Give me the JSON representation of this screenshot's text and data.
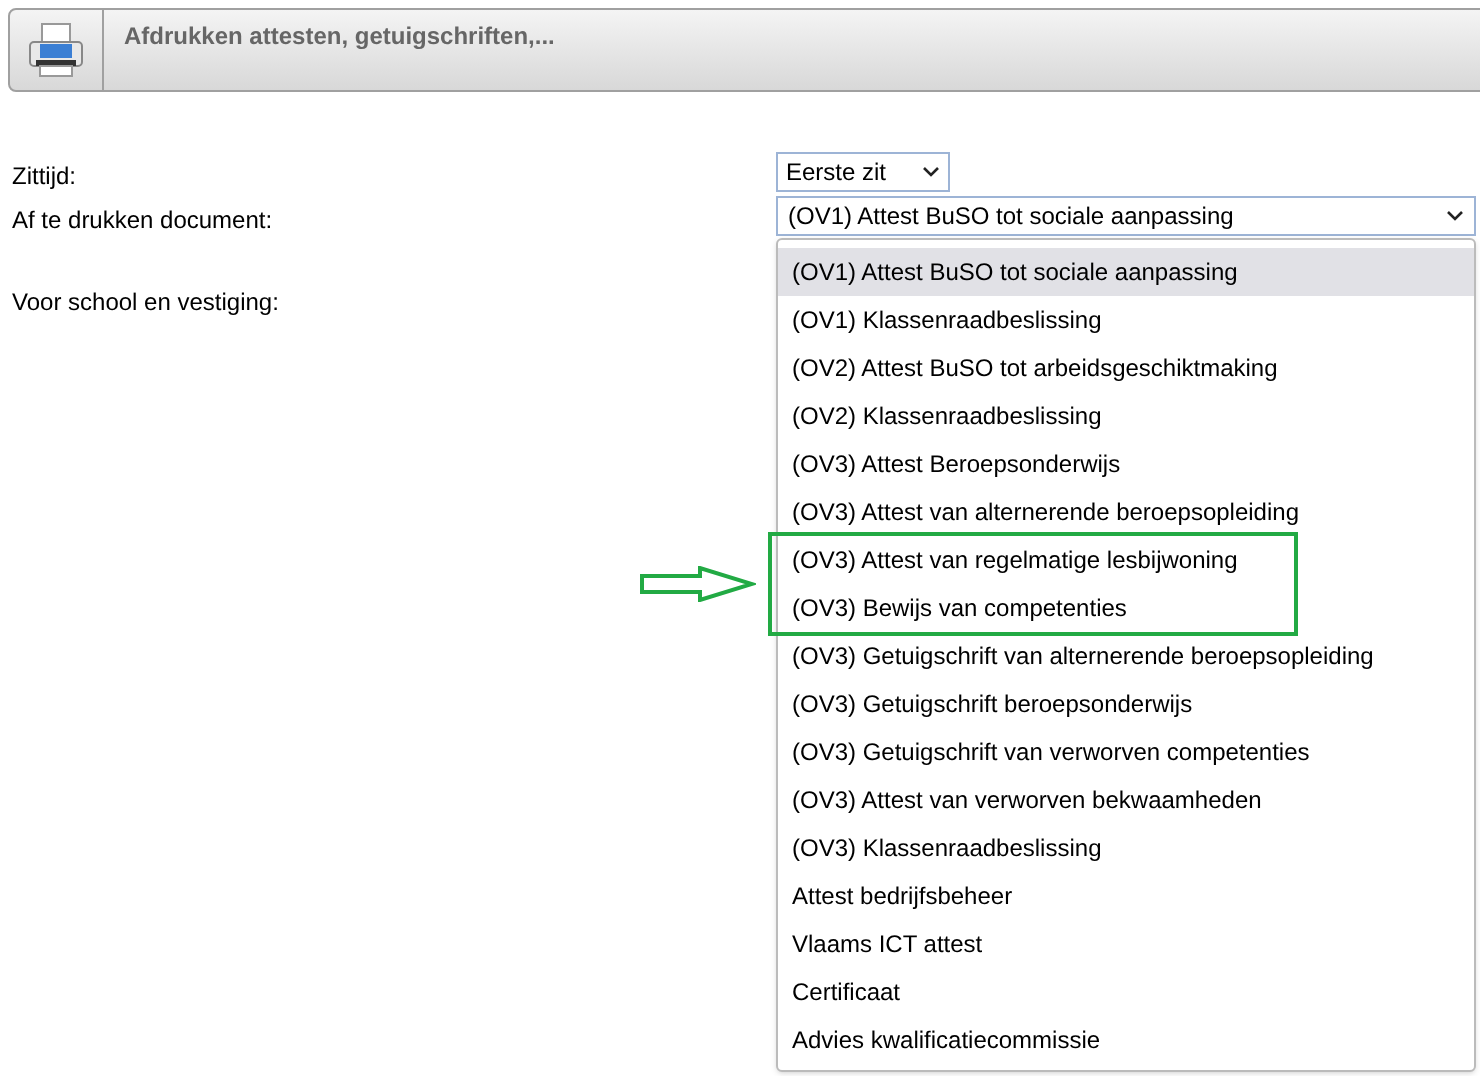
{
  "header": {
    "title": "Afdrukken attesten, getuigschriften,..."
  },
  "form": {
    "session_label": "Zittijd:",
    "session_value": "Eerste zit",
    "document_label": "Af te drukken document:",
    "document_value": "(OV1) Attest BuSO tot sociale aanpassing",
    "school_label": "Voor school en vestiging:"
  },
  "dropdown_options": [
    {
      "label": "(OV1) Attest BuSO tot sociale aanpassing",
      "selected": true,
      "highlighted": false
    },
    {
      "label": "(OV1) Klassenraadbeslissing",
      "selected": false,
      "highlighted": false
    },
    {
      "label": "(OV2) Attest BuSO tot arbeidsgeschiktmaking",
      "selected": false,
      "highlighted": false
    },
    {
      "label": "(OV2) Klassenraadbeslissing",
      "selected": false,
      "highlighted": false
    },
    {
      "label": "(OV3) Attest Beroepsonderwijs",
      "selected": false,
      "highlighted": false
    },
    {
      "label": "(OV3) Attest van alternerende beroepsopleiding",
      "selected": false,
      "highlighted": false
    },
    {
      "label": "(OV3) Attest van regelmatige lesbijwoning",
      "selected": false,
      "highlighted": true
    },
    {
      "label": "(OV3) Bewijs van competenties",
      "selected": false,
      "highlighted": true
    },
    {
      "label": "(OV3) Getuigschrift van alternerende beroepsopleiding",
      "selected": false,
      "highlighted": false
    },
    {
      "label": "(OV3) Getuigschrift beroepsonderwijs",
      "selected": false,
      "highlighted": false
    },
    {
      "label": "(OV3) Getuigschrift van verworven competenties",
      "selected": false,
      "highlighted": false
    },
    {
      "label": "(OV3) Attest van verworven bekwaamheden",
      "selected": false,
      "highlighted": false
    },
    {
      "label": "(OV3) Klassenraadbeslissing",
      "selected": false,
      "highlighted": false
    },
    {
      "label": "Attest bedrijfsbeheer",
      "selected": false,
      "highlighted": false
    },
    {
      "label": "Vlaams ICT attest",
      "selected": false,
      "highlighted": false
    },
    {
      "label": "Certificaat",
      "selected": false,
      "highlighted": false
    },
    {
      "label": "Advies kwalificatiecommissie",
      "selected": false,
      "highlighted": false
    }
  ]
}
